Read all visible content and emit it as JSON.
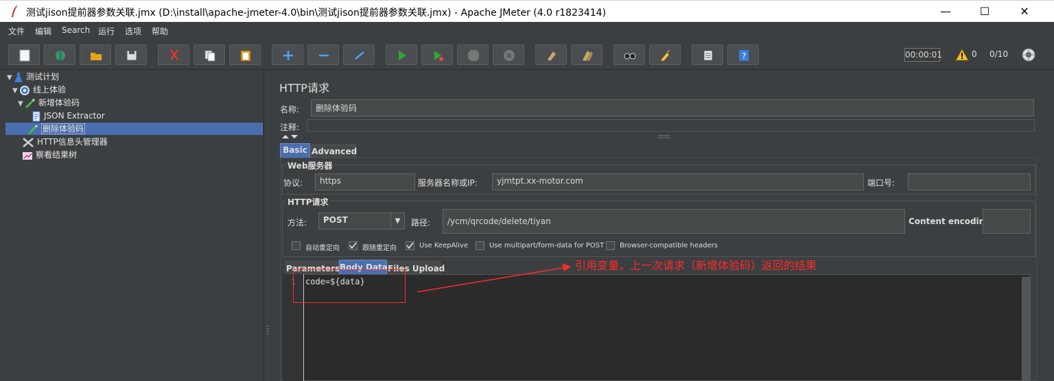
{
  "window": {
    "title": "测试jison提前器参数关联.jmx (D:\\install\\apache-jmeter-4.0\\bin\\测试jison提前器参数关联.jmx) - Apache JMeter (4.0 r1823414)",
    "minimize_glyph": "—",
    "maximize_glyph": "☐",
    "close_glyph": "✕"
  },
  "menu": [
    "文件",
    "编辑",
    "Search",
    "运行",
    "选项",
    "帮助"
  ],
  "toolbar": {
    "buttons": [
      "new-icon",
      "templates-icon",
      "open-icon",
      "save-icon",
      "cut-icon",
      "copy-icon",
      "paste-icon",
      "expand-icon",
      "collapse-icon",
      "toggle-icon",
      "start-icon",
      "start-no-pause-icon",
      "stop-icon",
      "shutdown-icon",
      "clear-icon",
      "clear-all-icon",
      "search-icon",
      "reset-search-icon",
      "function-helper-icon",
      "help-icon"
    ],
    "timer": "00:00:01",
    "warnings": "0",
    "threads": "0/10"
  },
  "tree": {
    "items": [
      {
        "label": "测试计划",
        "icon": "test-plan-icon",
        "expanded": true
      },
      {
        "label": "线上体验",
        "icon": "thread-group-icon",
        "expanded": true
      },
      {
        "label": "新增体验码",
        "icon": "http-sampler-icon",
        "expanded": true
      },
      {
        "label": "JSON Extractor",
        "icon": "extractor-icon"
      },
      {
        "label": "删除体验码",
        "icon": "http-sampler-icon",
        "selected": true
      },
      {
        "label": "HTTP信息头管理器",
        "icon": "header-manager-icon"
      },
      {
        "label": "察看结果树",
        "icon": "result-tree-icon"
      }
    ]
  },
  "panel": {
    "title": "HTTP请求",
    "name_label": "名称:",
    "name_value": "删除体验码",
    "comment_label": "注释:",
    "comment_value": "",
    "tabs": [
      "Basic",
      "Advanced"
    ],
    "web_server": {
      "legend": "Web服务器",
      "protocol_label": "协议:",
      "protocol_value": "https",
      "server_label": "服务器名称或IP:",
      "server_value": "yjmtpt.xx-motor.com",
      "port_label": "端口号:",
      "port_value": ""
    },
    "http_request": {
      "legend": "HTTP请求",
      "method_label": "方法:",
      "method_value": "POST",
      "path_label": "路径:",
      "path_value": "/ycm/qrcode/delete/tiyan",
      "encoding_label": "Content encoding:",
      "encoding_value": ""
    },
    "options": [
      {
        "label": "自动重定向",
        "checked": false
      },
      {
        "label": "跟随重定向",
        "checked": true
      },
      {
        "label": "Use KeepAlive",
        "checked": true
      },
      {
        "label": "Use multipart/form-data for POST",
        "checked": false
      },
      {
        "label": "Browser-compatible headers",
        "checked": false
      }
    ],
    "body_tabs": [
      "Parameters",
      "Body Data",
      "Files Upload"
    ],
    "body": {
      "line_number": "1",
      "content": "code=${data}"
    }
  },
  "annotation": {
    "text": "引用变量，上一次请求（新增体验码）返回的结果"
  },
  "colors": {
    "background": "#3c3f41",
    "selection": "#4b6eaf",
    "annotation": "#ff2a2a"
  }
}
